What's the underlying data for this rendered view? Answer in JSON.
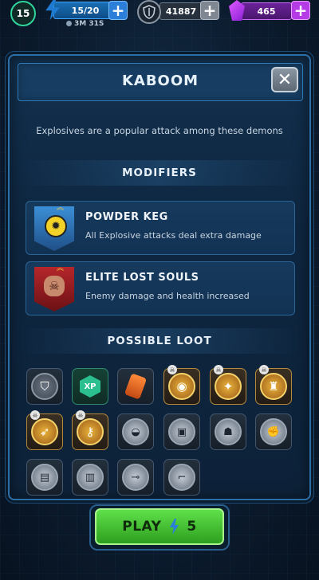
{
  "header": {
    "level": "15",
    "energy": "15/20",
    "energy_timer": "3M 31S",
    "coins": "41887",
    "gems": "465",
    "plus": "+"
  },
  "mission": {
    "title": "KABOOM",
    "description": "Explosives are a popular attack among these demons",
    "close_label": "✕"
  },
  "modifiers": {
    "heading": "MODIFIERS",
    "items": [
      {
        "name": "POWDER KEG",
        "description": "All Explosive attacks deal extra damage"
      },
      {
        "name": "ELITE LOST SOULS",
        "description": "Enemy damage and health increased"
      }
    ]
  },
  "loot": {
    "heading": "POSSIBLE LOOT",
    "xp_label": "XP"
  },
  "play": {
    "label": "PLAY",
    "cost": "5"
  },
  "colors": {
    "accent_blue": "#2c6fa6",
    "play_green": "#3fbf2c",
    "gem_purple": "#b53be6"
  }
}
